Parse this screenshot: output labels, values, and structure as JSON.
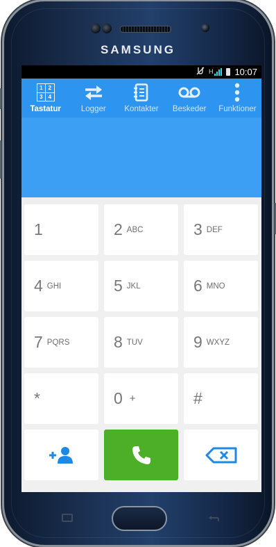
{
  "device": {
    "brand": "SAMSUNG"
  },
  "status_bar": {
    "time": "10:07",
    "network_type": "H",
    "icons": [
      "mute-icon",
      "signal-icon",
      "battery-icon"
    ]
  },
  "tabs": [
    {
      "id": "tastatur",
      "label": "Tastatur",
      "icon": "dialpad-icon",
      "active": true
    },
    {
      "id": "logger",
      "label": "Logger",
      "icon": "swap-arrows-icon",
      "active": false
    },
    {
      "id": "kontakter",
      "label": "Kontakter",
      "icon": "contacts-book-icon",
      "active": false
    },
    {
      "id": "beskeder",
      "label": "Beskeder",
      "icon": "voicemail-icon",
      "active": false
    },
    {
      "id": "funktioner",
      "label": "Funktioner",
      "icon": "more-vert-icon",
      "active": false
    }
  ],
  "dialpad_icon_digits": [
    "1",
    "2",
    "3",
    "4"
  ],
  "number_display": {
    "value": ""
  },
  "keys": [
    {
      "digit": "1",
      "letters": ""
    },
    {
      "digit": "2",
      "letters": "ABC"
    },
    {
      "digit": "3",
      "letters": "DEF"
    },
    {
      "digit": "4",
      "letters": "GHI"
    },
    {
      "digit": "5",
      "letters": "JKL"
    },
    {
      "digit": "6",
      "letters": "MNO"
    },
    {
      "digit": "7",
      "letters": "PQRS"
    },
    {
      "digit": "8",
      "letters": "TUV"
    },
    {
      "digit": "9",
      "letters": "WXYZ"
    },
    {
      "digit": "*",
      "letters": ""
    },
    {
      "digit": "0",
      "letters": "+"
    },
    {
      "digit": "#",
      "letters": ""
    }
  ],
  "colors": {
    "tab_bar": "#2d95ef",
    "display_bg": "#3d9ff3",
    "call_button": "#4caf27",
    "accent_icon": "#1e88e5"
  }
}
